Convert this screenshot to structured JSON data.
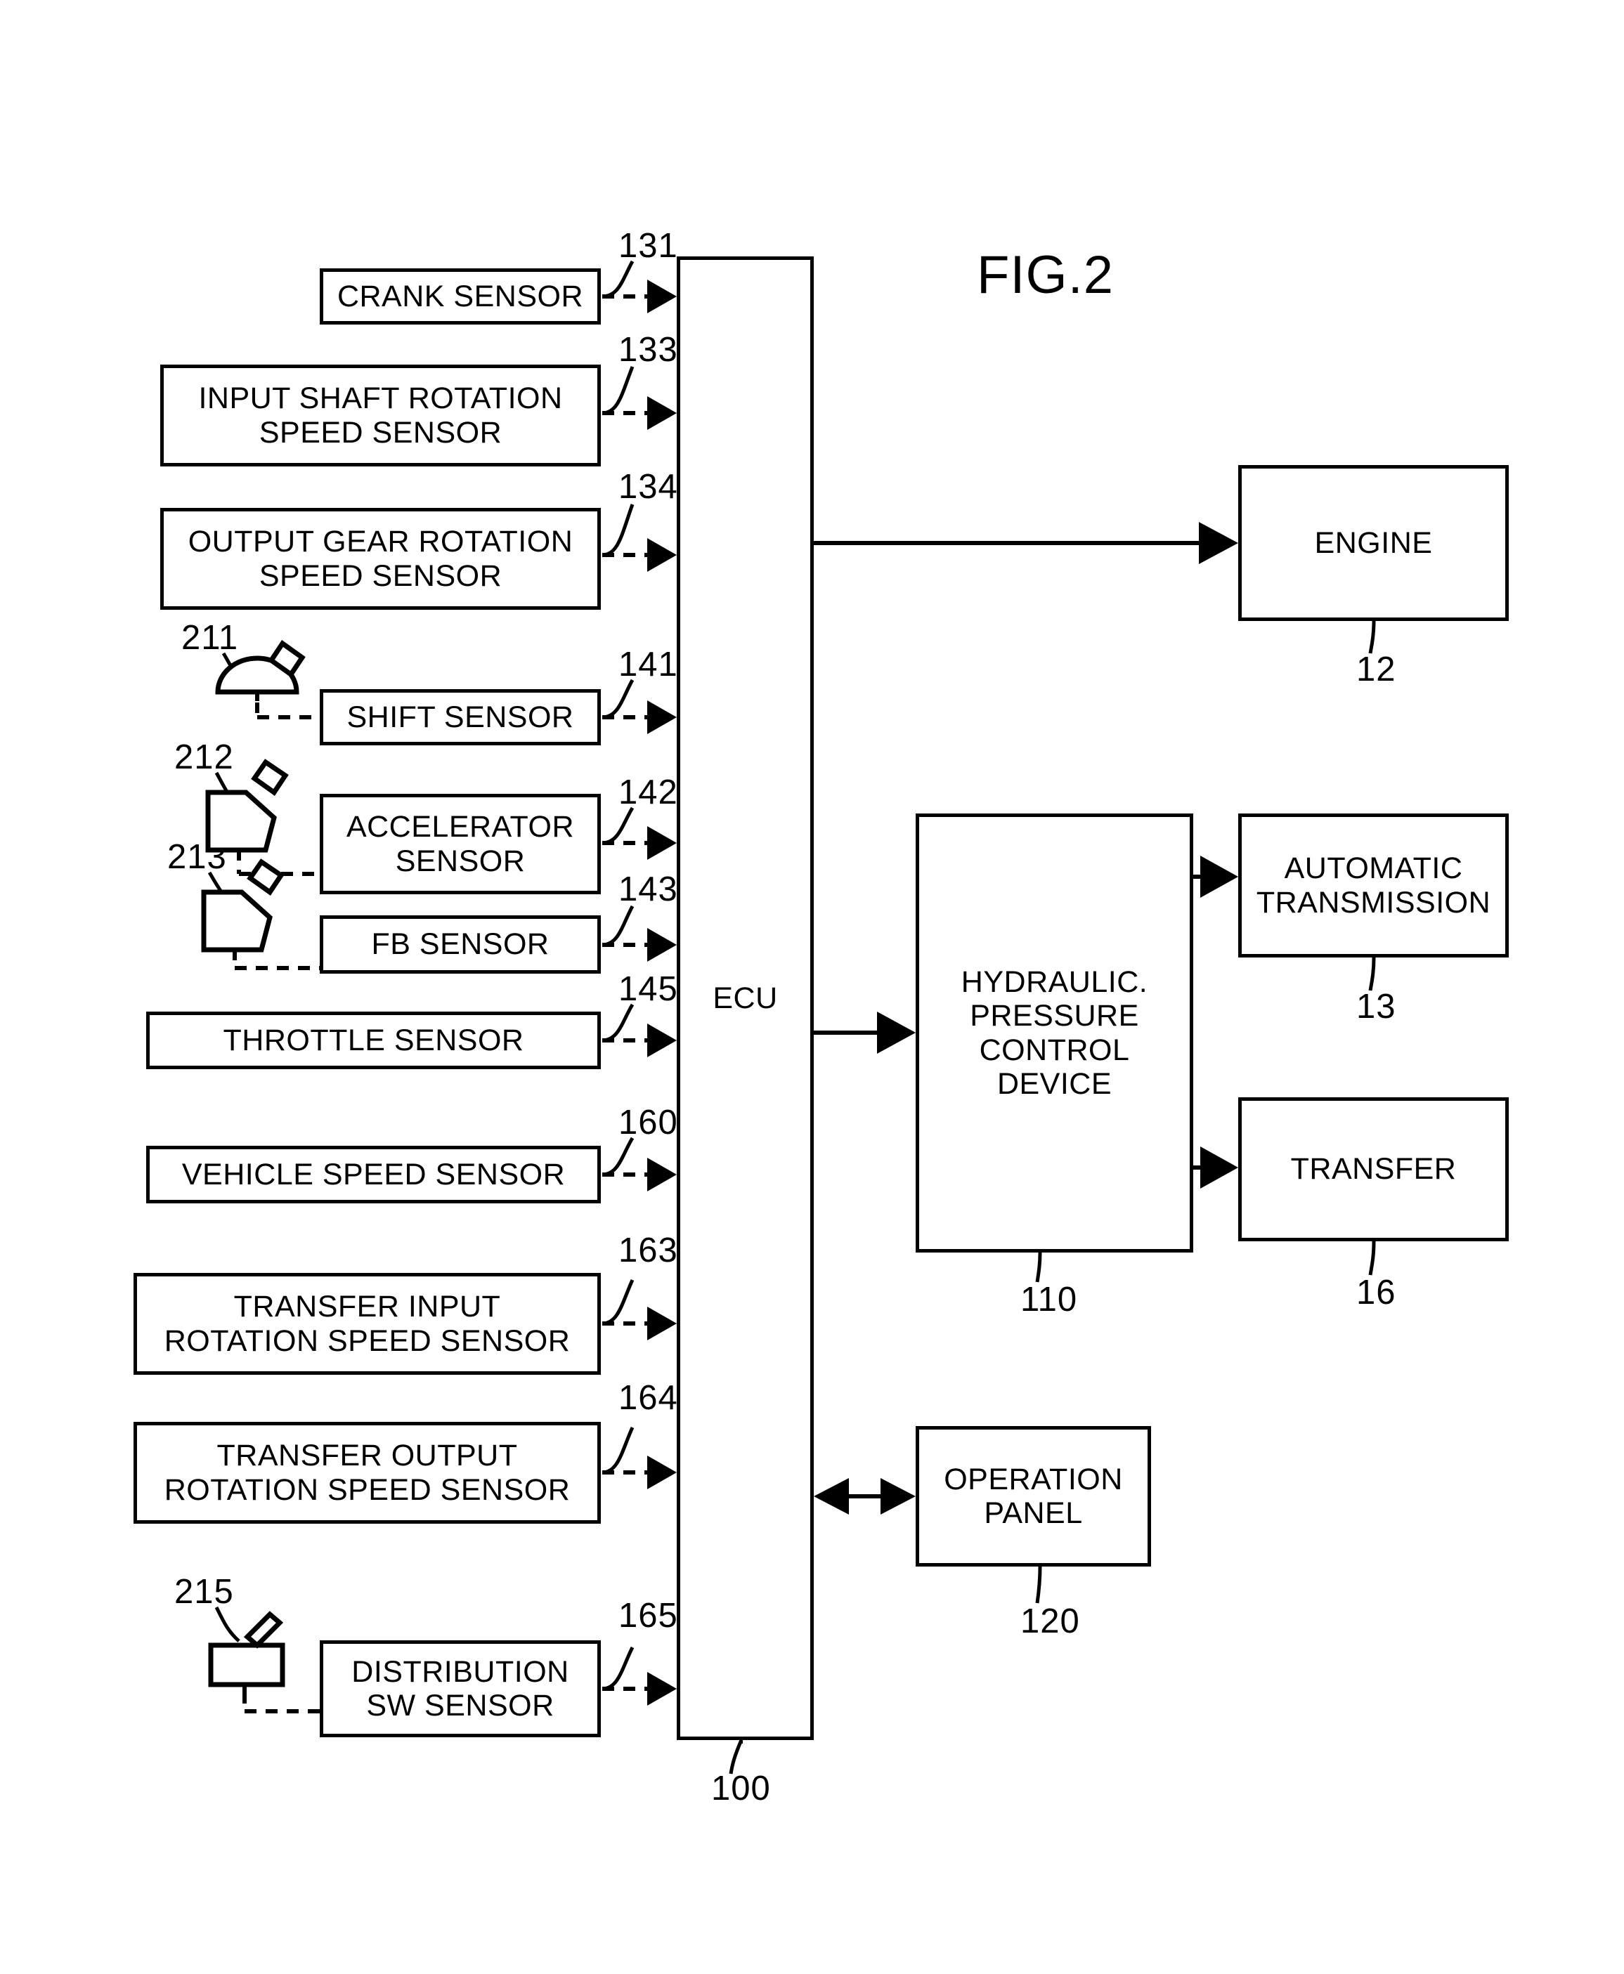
{
  "figure": {
    "title": "FIG.2"
  },
  "sensors": [
    {
      "label": "CRANK SENSOR",
      "ref": "131"
    },
    {
      "label": "INPUT SHAFT ROTATION\nSPEED SENSOR",
      "ref": "133"
    },
    {
      "label": "OUTPUT GEAR ROTATION\nSPEED SENSOR",
      "ref": "134"
    },
    {
      "label": "SHIFT SENSOR",
      "ref": "141"
    },
    {
      "label": "ACCELERATOR\nSENSOR",
      "ref": "142"
    },
    {
      "label": "FB SENSOR",
      "ref": "143"
    },
    {
      "label": "THROTTLE SENSOR",
      "ref": "145"
    },
    {
      "label": "VEHICLE SPEED SENSOR",
      "ref": "160"
    },
    {
      "label": "TRANSFER INPUT\nROTATION SPEED SENSOR",
      "ref": "163"
    },
    {
      "label": "TRANSFER OUTPUT\nROTATION SPEED SENSOR",
      "ref": "164"
    },
    {
      "label": "DISTRIBUTION\nSW SENSOR",
      "ref": "165"
    }
  ],
  "input_devices": [
    {
      "ref": "211",
      "icon": "shift-lever-icon"
    },
    {
      "ref": "212",
      "icon": "accelerator-pedal-icon"
    },
    {
      "ref": "213",
      "icon": "brake-pedal-icon"
    },
    {
      "ref": "215",
      "icon": "distribution-switch-icon"
    }
  ],
  "controller": {
    "label": "ECU",
    "ref": "100"
  },
  "actuators": [
    {
      "label": "ENGINE",
      "ref": "12"
    },
    {
      "label": "HYDRAULIC.\nPRESSURE\nCONTROL\nDEVICE",
      "ref": "110"
    },
    {
      "label": "AUTOMATIC\nTRANSMISSION",
      "ref": "13"
    },
    {
      "label": "TRANSFER",
      "ref": "16"
    },
    {
      "label": "OPERATION\nPANEL",
      "ref": "120"
    }
  ],
  "colors": {
    "ink": "#000000",
    "paper": "#ffffff"
  }
}
